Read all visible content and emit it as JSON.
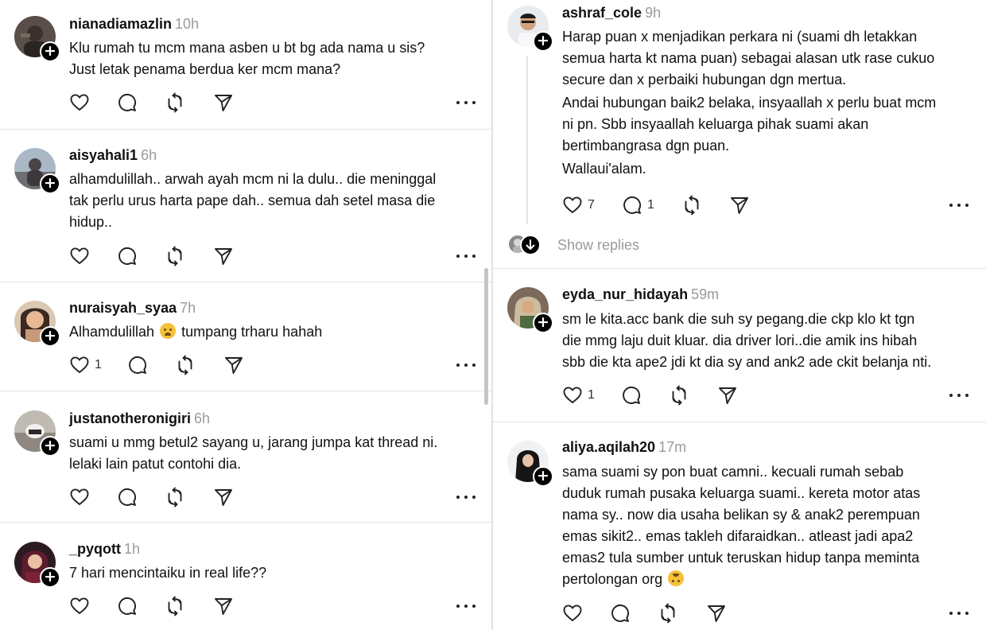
{
  "left_posts": [
    {
      "username": "nianadiamazlin",
      "time": "10h",
      "lines": [
        "Klu rumah tu mcm mana asben u bt bg ada nama u sis?",
        "Just letak penama berdua ker mcm mana?"
      ],
      "like_count": "",
      "reply_count": ""
    },
    {
      "username": "aisyahali1",
      "time": "6h",
      "lines": [
        "alhamdulillah.. arwah ayah mcm ni la dulu.. die meninggal",
        "tak perlu urus harta pape dah.. semua dah setel masa die",
        "hidup.."
      ],
      "like_count": "",
      "reply_count": ""
    },
    {
      "username": "nuraisyah_syaa",
      "time": "7h",
      "text_before_emoji": "Alhamdulillah",
      "emoji": "crying-face",
      "text_after_emoji": "tumpang trharu hahah",
      "like_count": "1",
      "reply_count": ""
    },
    {
      "username": "justanotheronigiri",
      "time": "6h",
      "lines": [
        "suami u mmg betul2 sayang u, jarang jumpa kat thread ni.",
        "lelaki lain patut contohi dia."
      ],
      "like_count": "",
      "reply_count": ""
    },
    {
      "username": "_pyqott",
      "time": "1h",
      "lines": [
        "7 hari mencintaiku in real life??"
      ],
      "like_count": "",
      "reply_count": ""
    }
  ],
  "right_posts": [
    {
      "username": "ashraf_cole",
      "time": "9h",
      "paragraphs": [
        [
          "Harap puan x menjadikan perkara ni (suami dh letakkan",
          "semua harta kt nama puan) sebagai alasan utk rase cukuo",
          "secure dan x perbaiki hubungan dgn mertua."
        ],
        [
          "Andai hubungan baik2 belaka, insyaallah x perlu buat mcm",
          "ni pn. Sbb insyaallah keluarga pihak suami akan",
          "bertimbangrasa dgn puan."
        ],
        [
          "Wallaui'alam."
        ]
      ],
      "like_count": "7",
      "reply_count": "1",
      "show_replies_label": "Show replies"
    },
    {
      "username": "eyda_nur_hidayah",
      "time": "59m",
      "lines": [
        "sm le kita.acc bank die suh sy pegang.die ckp klo kt tgn",
        "die mmg laju duit kluar. dia driver lori..die amik ins hibah",
        "sbb die kta ape2 jdi kt dia sy and ank2 ade ckit belanja nti."
      ],
      "like_count": "1",
      "reply_count": ""
    },
    {
      "username": "aliya.aqilah20",
      "time": "17m",
      "lines": [
        "sama suami sy pon buat camni.. kecuali rumah sebab",
        "duduk rumah pusaka keluarga suami.. kereta motor atas",
        "nama sy.. now dia usaha belikan sy & anak2 perempuan",
        "emas sikit2.. emas takleh difaraidkan.. atleast jadi apa2",
        "emas2 tula sumber untuk teruskan hidup tanpa meminta"
      ],
      "last_line_text": "pertolongan org",
      "last_line_emoji": "upside-down-face",
      "like_count": "",
      "reply_count": ""
    }
  ],
  "icons": {
    "like": "heart-icon",
    "reply": "comment-icon",
    "repost": "repost-icon",
    "share": "send-icon",
    "more": "more-icon",
    "follow": "plus-icon",
    "expand": "arrow-down-icon"
  },
  "colors": {
    "text": "#111111",
    "muted": "#9a9a9a",
    "divider": "#e4e4e4",
    "icon": "#222222"
  }
}
